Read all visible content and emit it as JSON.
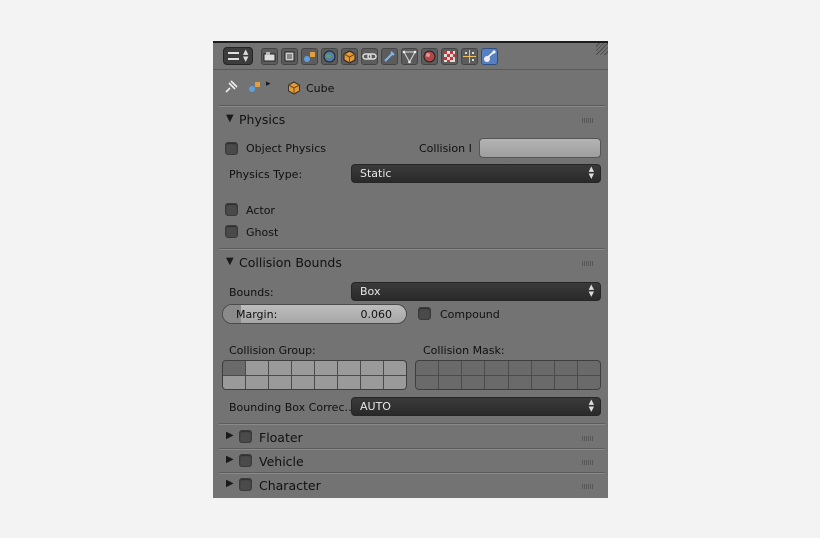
{
  "breadcrumb": {
    "object_name": "Cube"
  },
  "physics": {
    "header": "Physics",
    "object_physics_label": "Object Physics",
    "collision_label": "Collision I",
    "physics_type_label": "Physics Type:",
    "physics_type_value": "Static",
    "actor_label": "Actor",
    "ghost_label": "Ghost"
  },
  "collision_bounds": {
    "header": "Collision Bounds",
    "bounds_label": "Bounds:",
    "bounds_value": "Box",
    "margin_label": "Margin:",
    "margin_value": "0.060",
    "compound_label": "Compound",
    "collision_group_label": "Collision Group:",
    "collision_mask_label": "Collision Mask:",
    "bbox_label": "Bounding Box Correc…",
    "bbox_value": "AUTO"
  },
  "sections": {
    "floater": "Floater",
    "vehicle": "Vehicle",
    "character": "Character"
  },
  "toolbar_icons": [
    "render-icon",
    "render-layers-icon",
    "scene-icon",
    "world-icon",
    "object-icon",
    "constraints-icon",
    "modifiers-icon",
    "data-icon",
    "material-icon",
    "texture-icon",
    "particles-icon",
    "physics-icon"
  ]
}
